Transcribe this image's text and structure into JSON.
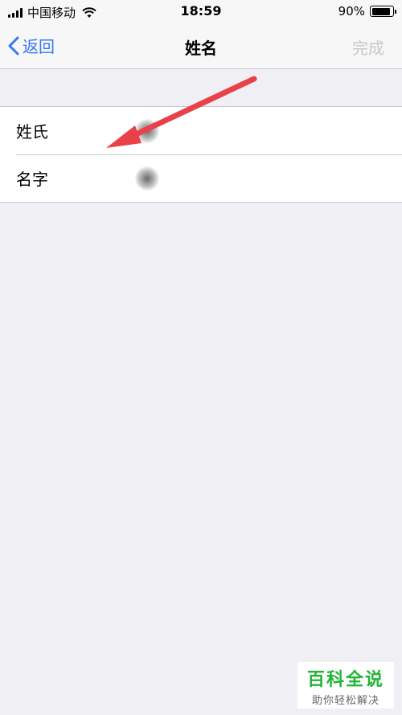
{
  "status_bar": {
    "carrier": "中国移动",
    "time": "18:59",
    "battery_percent": "90%",
    "battery_level": 0.9,
    "icons": [
      "signal-icon",
      "wifi-icon",
      "battery-icon"
    ]
  },
  "nav": {
    "back_label": "返回",
    "title": "姓名",
    "done_label": "完成"
  },
  "rows": [
    {
      "label": "姓氏"
    },
    {
      "label": "名字"
    }
  ],
  "annotation": {
    "arrow_color": "#e8414a"
  },
  "watermark": {
    "main": "百科全说",
    "sub": "助你轻松解决"
  },
  "colors": {
    "accent": "#3478f6",
    "disabled": "#c7c7cc",
    "background": "#efeff4",
    "watermark_green": "#21b535"
  }
}
